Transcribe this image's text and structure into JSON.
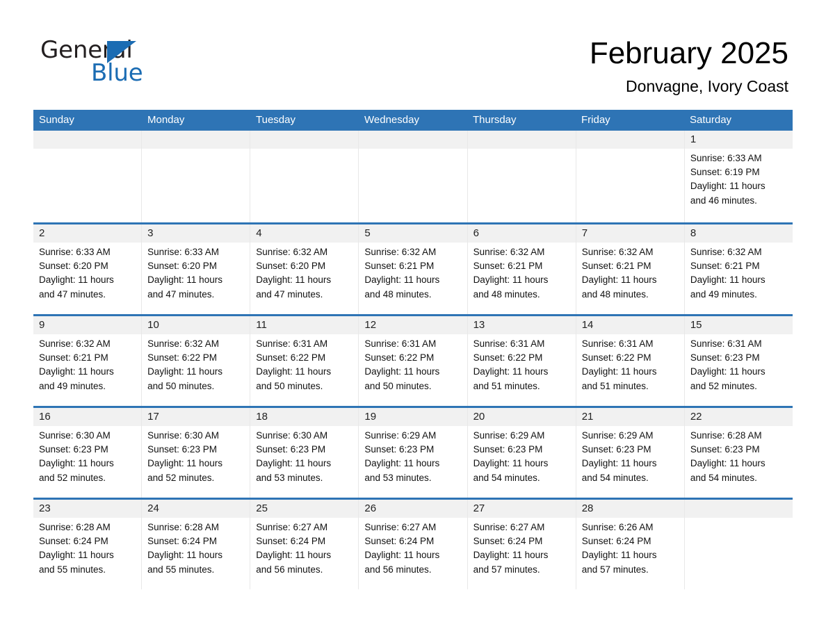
{
  "brand": {
    "name_part1": "General",
    "name_part2": "Blue",
    "accent_color": "#1b6cb3",
    "triangle_icon": "brand-triangle-icon"
  },
  "header": {
    "title": "February 2025",
    "subtitle": "Donvagne, Ivory Coast"
  },
  "theme": {
    "header_blue": "#2e74b5",
    "row_band_gray": "#f1f1f1",
    "column_divider": "#e8e8e8"
  },
  "weekdays": [
    "Sunday",
    "Monday",
    "Tuesday",
    "Wednesday",
    "Thursday",
    "Friday",
    "Saturday"
  ],
  "weeks": [
    [
      {
        "day": "",
        "sunrise": "",
        "sunset": "",
        "daylight_line1": "",
        "daylight_line2": "",
        "empty": true
      },
      {
        "day": "",
        "sunrise": "",
        "sunset": "",
        "daylight_line1": "",
        "daylight_line2": "",
        "empty": true
      },
      {
        "day": "",
        "sunrise": "",
        "sunset": "",
        "daylight_line1": "",
        "daylight_line2": "",
        "empty": true
      },
      {
        "day": "",
        "sunrise": "",
        "sunset": "",
        "daylight_line1": "",
        "daylight_line2": "",
        "empty": true
      },
      {
        "day": "",
        "sunrise": "",
        "sunset": "",
        "daylight_line1": "",
        "daylight_line2": "",
        "empty": true
      },
      {
        "day": "",
        "sunrise": "",
        "sunset": "",
        "daylight_line1": "",
        "daylight_line2": "",
        "empty": true
      },
      {
        "day": "1",
        "sunrise": "Sunrise: 6:33 AM",
        "sunset": "Sunset: 6:19 PM",
        "daylight_line1": "Daylight: 11 hours",
        "daylight_line2": "and 46 minutes.",
        "empty": false
      }
    ],
    [
      {
        "day": "2",
        "sunrise": "Sunrise: 6:33 AM",
        "sunset": "Sunset: 6:20 PM",
        "daylight_line1": "Daylight: 11 hours",
        "daylight_line2": "and 47 minutes.",
        "empty": false
      },
      {
        "day": "3",
        "sunrise": "Sunrise: 6:33 AM",
        "sunset": "Sunset: 6:20 PM",
        "daylight_line1": "Daylight: 11 hours",
        "daylight_line2": "and 47 minutes.",
        "empty": false
      },
      {
        "day": "4",
        "sunrise": "Sunrise: 6:32 AM",
        "sunset": "Sunset: 6:20 PM",
        "daylight_line1": "Daylight: 11 hours",
        "daylight_line2": "and 47 minutes.",
        "empty": false
      },
      {
        "day": "5",
        "sunrise": "Sunrise: 6:32 AM",
        "sunset": "Sunset: 6:21 PM",
        "daylight_line1": "Daylight: 11 hours",
        "daylight_line2": "and 48 minutes.",
        "empty": false
      },
      {
        "day": "6",
        "sunrise": "Sunrise: 6:32 AM",
        "sunset": "Sunset: 6:21 PM",
        "daylight_line1": "Daylight: 11 hours",
        "daylight_line2": "and 48 minutes.",
        "empty": false
      },
      {
        "day": "7",
        "sunrise": "Sunrise: 6:32 AM",
        "sunset": "Sunset: 6:21 PM",
        "daylight_line1": "Daylight: 11 hours",
        "daylight_line2": "and 48 minutes.",
        "empty": false
      },
      {
        "day": "8",
        "sunrise": "Sunrise: 6:32 AM",
        "sunset": "Sunset: 6:21 PM",
        "daylight_line1": "Daylight: 11 hours",
        "daylight_line2": "and 49 minutes.",
        "empty": false
      }
    ],
    [
      {
        "day": "9",
        "sunrise": "Sunrise: 6:32 AM",
        "sunset": "Sunset: 6:21 PM",
        "daylight_line1": "Daylight: 11 hours",
        "daylight_line2": "and 49 minutes.",
        "empty": false
      },
      {
        "day": "10",
        "sunrise": "Sunrise: 6:32 AM",
        "sunset": "Sunset: 6:22 PM",
        "daylight_line1": "Daylight: 11 hours",
        "daylight_line2": "and 50 minutes.",
        "empty": false
      },
      {
        "day": "11",
        "sunrise": "Sunrise: 6:31 AM",
        "sunset": "Sunset: 6:22 PM",
        "daylight_line1": "Daylight: 11 hours",
        "daylight_line2": "and 50 minutes.",
        "empty": false
      },
      {
        "day": "12",
        "sunrise": "Sunrise: 6:31 AM",
        "sunset": "Sunset: 6:22 PM",
        "daylight_line1": "Daylight: 11 hours",
        "daylight_line2": "and 50 minutes.",
        "empty": false
      },
      {
        "day": "13",
        "sunrise": "Sunrise: 6:31 AM",
        "sunset": "Sunset: 6:22 PM",
        "daylight_line1": "Daylight: 11 hours",
        "daylight_line2": "and 51 minutes.",
        "empty": false
      },
      {
        "day": "14",
        "sunrise": "Sunrise: 6:31 AM",
        "sunset": "Sunset: 6:22 PM",
        "daylight_line1": "Daylight: 11 hours",
        "daylight_line2": "and 51 minutes.",
        "empty": false
      },
      {
        "day": "15",
        "sunrise": "Sunrise: 6:31 AM",
        "sunset": "Sunset: 6:23 PM",
        "daylight_line1": "Daylight: 11 hours",
        "daylight_line2": "and 52 minutes.",
        "empty": false
      }
    ],
    [
      {
        "day": "16",
        "sunrise": "Sunrise: 6:30 AM",
        "sunset": "Sunset: 6:23 PM",
        "daylight_line1": "Daylight: 11 hours",
        "daylight_line2": "and 52 minutes.",
        "empty": false
      },
      {
        "day": "17",
        "sunrise": "Sunrise: 6:30 AM",
        "sunset": "Sunset: 6:23 PM",
        "daylight_line1": "Daylight: 11 hours",
        "daylight_line2": "and 52 minutes.",
        "empty": false
      },
      {
        "day": "18",
        "sunrise": "Sunrise: 6:30 AM",
        "sunset": "Sunset: 6:23 PM",
        "daylight_line1": "Daylight: 11 hours",
        "daylight_line2": "and 53 minutes.",
        "empty": false
      },
      {
        "day": "19",
        "sunrise": "Sunrise: 6:29 AM",
        "sunset": "Sunset: 6:23 PM",
        "daylight_line1": "Daylight: 11 hours",
        "daylight_line2": "and 53 minutes.",
        "empty": false
      },
      {
        "day": "20",
        "sunrise": "Sunrise: 6:29 AM",
        "sunset": "Sunset: 6:23 PM",
        "daylight_line1": "Daylight: 11 hours",
        "daylight_line2": "and 54 minutes.",
        "empty": false
      },
      {
        "day": "21",
        "sunrise": "Sunrise: 6:29 AM",
        "sunset": "Sunset: 6:23 PM",
        "daylight_line1": "Daylight: 11 hours",
        "daylight_line2": "and 54 minutes.",
        "empty": false
      },
      {
        "day": "22",
        "sunrise": "Sunrise: 6:28 AM",
        "sunset": "Sunset: 6:23 PM",
        "daylight_line1": "Daylight: 11 hours",
        "daylight_line2": "and 54 minutes.",
        "empty": false
      }
    ],
    [
      {
        "day": "23",
        "sunrise": "Sunrise: 6:28 AM",
        "sunset": "Sunset: 6:24 PM",
        "daylight_line1": "Daylight: 11 hours",
        "daylight_line2": "and 55 minutes.",
        "empty": false
      },
      {
        "day": "24",
        "sunrise": "Sunrise: 6:28 AM",
        "sunset": "Sunset: 6:24 PM",
        "daylight_line1": "Daylight: 11 hours",
        "daylight_line2": "and 55 minutes.",
        "empty": false
      },
      {
        "day": "25",
        "sunrise": "Sunrise: 6:27 AM",
        "sunset": "Sunset: 6:24 PM",
        "daylight_line1": "Daylight: 11 hours",
        "daylight_line2": "and 56 minutes.",
        "empty": false
      },
      {
        "day": "26",
        "sunrise": "Sunrise: 6:27 AM",
        "sunset": "Sunset: 6:24 PM",
        "daylight_line1": "Daylight: 11 hours",
        "daylight_line2": "and 56 minutes.",
        "empty": false
      },
      {
        "day": "27",
        "sunrise": "Sunrise: 6:27 AM",
        "sunset": "Sunset: 6:24 PM",
        "daylight_line1": "Daylight: 11 hours",
        "daylight_line2": "and 57 minutes.",
        "empty": false
      },
      {
        "day": "28",
        "sunrise": "Sunrise: 6:26 AM",
        "sunset": "Sunset: 6:24 PM",
        "daylight_line1": "Daylight: 11 hours",
        "daylight_line2": "and 57 minutes.",
        "empty": false
      },
      {
        "day": "",
        "sunrise": "",
        "sunset": "",
        "daylight_line1": "",
        "daylight_line2": "",
        "empty": true
      }
    ]
  ]
}
